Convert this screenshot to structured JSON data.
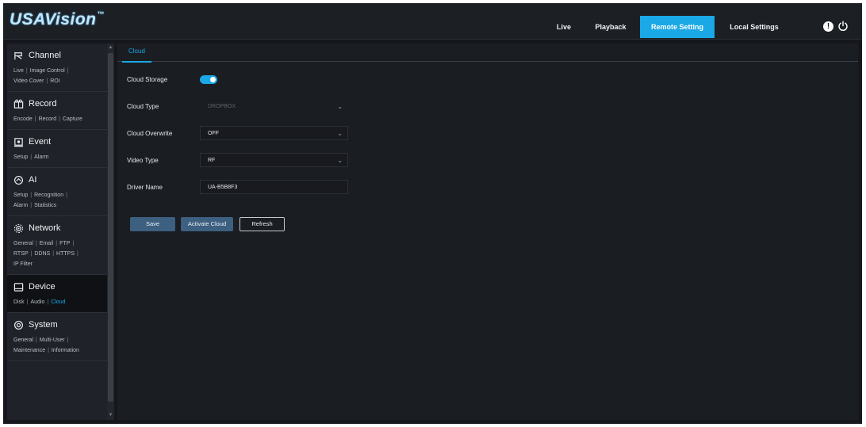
{
  "app": {
    "logo": "USAVision",
    "logo_mark": "™"
  },
  "nav": {
    "live": "Live",
    "playback": "Playback",
    "remote_setting": "Remote Setting",
    "local_settings": "Local Settings",
    "active": "Remote Setting"
  },
  "header_icons": [
    "info-icon",
    "power-icon"
  ],
  "colors": {
    "accent": "#1aa8e6",
    "background": "#15171c",
    "panel": "#1f2228",
    "button": "#3d5f80"
  },
  "sidebar": {
    "sections": [
      {
        "title": "Channel",
        "icon": "channel-icon",
        "links": [
          [
            "Live",
            "Image Control"
          ],
          [
            "Video Cover",
            "ROI"
          ]
        ]
      },
      {
        "title": "Record",
        "icon": "record-icon",
        "links": [
          [
            "Encode",
            "Record",
            "Capture"
          ]
        ]
      },
      {
        "title": "Event",
        "icon": "event-icon",
        "links": [
          [
            "Setup",
            "Alarm"
          ]
        ]
      },
      {
        "title": "AI",
        "icon": "ai-icon",
        "links": [
          [
            "Setup",
            "Recognition"
          ],
          [
            "Alarm",
            "Statistics"
          ]
        ]
      },
      {
        "title": "Network",
        "icon": "network-icon",
        "links": [
          [
            "General",
            "Email",
            "FTP"
          ],
          [
            "RTSP",
            "DDNS",
            "HTTPS"
          ],
          [
            "IP Filter"
          ]
        ]
      },
      {
        "title": "Device",
        "icon": "device-icon",
        "links": [
          [
            "Disk",
            "Audio",
            "Cloud"
          ]
        ]
      },
      {
        "title": "System",
        "icon": "system-icon",
        "links": [
          [
            "General",
            "Multi-User"
          ],
          [
            "Maintenance",
            "Information"
          ]
        ]
      }
    ],
    "active_section": "Device",
    "active_link": "Cloud"
  },
  "main": {
    "tab": "Cloud",
    "fields": {
      "cloud_storage": {
        "label": "Cloud Storage",
        "enabled": true
      },
      "cloud_type": {
        "label": "Cloud Type",
        "value": "DROPBOX"
      },
      "cloud_overwrite": {
        "label": "Cloud Overwrite",
        "value": "OFF"
      },
      "video_type": {
        "label": "Video Type",
        "value": "RF"
      },
      "drive_name": {
        "label": "Driver Name",
        "value": "UA-B5B8F3"
      }
    },
    "buttons": {
      "save": "Save",
      "activate": "Activate Cloud",
      "refresh": "Refresh"
    }
  }
}
